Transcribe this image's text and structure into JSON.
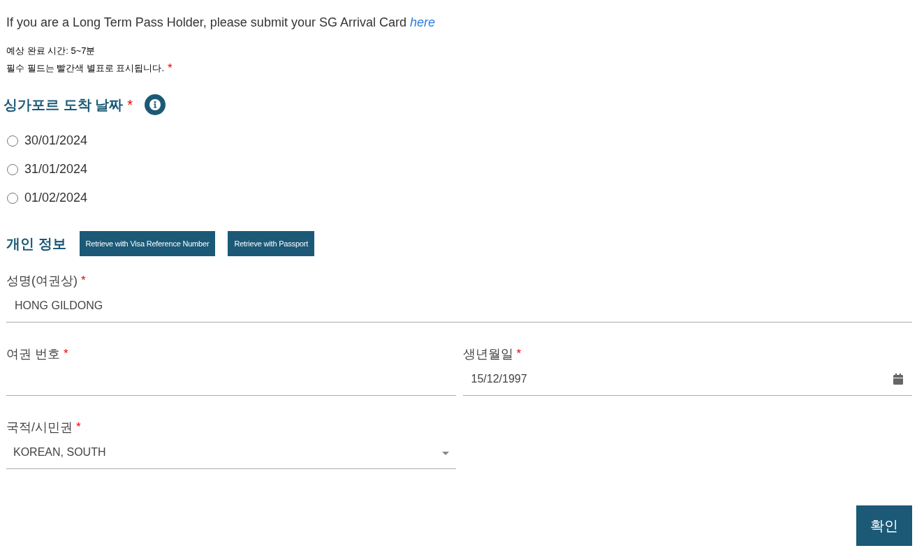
{
  "notice": {
    "text": "If you are a Long Term Pass Holder, please submit your SG Arrival Card",
    "link": "here"
  },
  "estimated_time": "예상 완료 시간: 5~7분",
  "required_note": {
    "text": "필수 필드는 빨간색 별표로 표시됩니다.",
    "mark": "*"
  },
  "arrival_date": {
    "heading": "싱가포르 도착 날짜",
    "required_mark": "*",
    "options": [
      {
        "label": "30/01/2024",
        "selected": false
      },
      {
        "label": "31/01/2024",
        "selected": false
      },
      {
        "label": "01/02/2024",
        "selected": false
      }
    ]
  },
  "personal_info": {
    "heading": "개인 정보",
    "buttons": [
      "Retrieve with Visa Reference Number",
      "Retrieve with Passport"
    ],
    "name_field": {
      "kind": "text",
      "label": "성명(여권상)",
      "required_mark": "*",
      "value": "HONG GILDONG"
    },
    "fields": [
      {
        "kind": "text",
        "label": "여권 번호",
        "required_mark": "*"
      },
      {
        "kind": "date",
        "label": "생년월일",
        "required_mark": "*",
        "value": "15/12/1997"
      },
      {
        "kind": "select",
        "label": "국적/시민권",
        "required_mark": "*",
        "value": "KOREAN, SOUTH"
      }
    ]
  },
  "submit_button": "확인"
}
